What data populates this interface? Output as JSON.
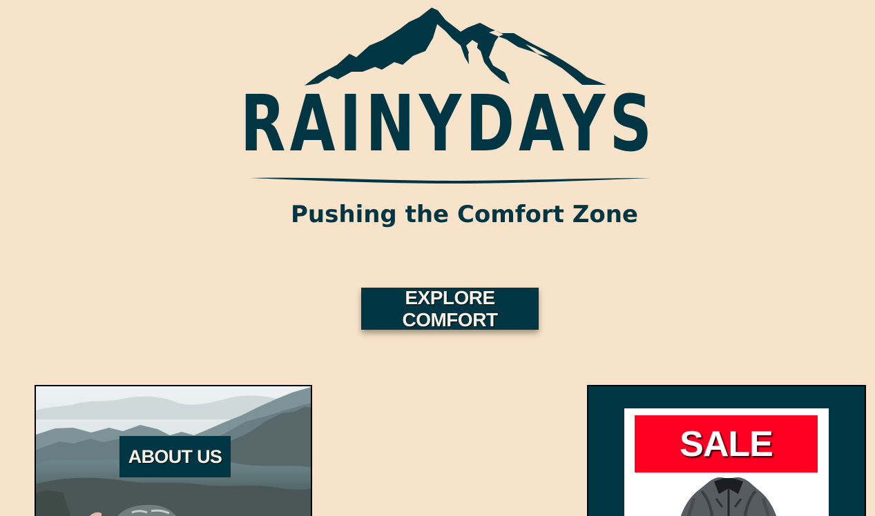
{
  "header": {
    "brand_name": "RAINYDAYS",
    "tagline": "Pushing the Comfort Zone",
    "explore_button": "EXPLORE COMFORT"
  },
  "cards": {
    "about": {
      "label": "ABOUT US"
    },
    "sale": {
      "label": "SALE"
    }
  },
  "icons": {
    "mountain": "mountain-logo-icon",
    "tagline_left": "cross-icon",
    "tagline_right": "cross-icon",
    "jacket": "jacket-image"
  },
  "colors": {
    "background": "#f7e3ca",
    "brand": "#003643",
    "sale": "#ff0022"
  }
}
